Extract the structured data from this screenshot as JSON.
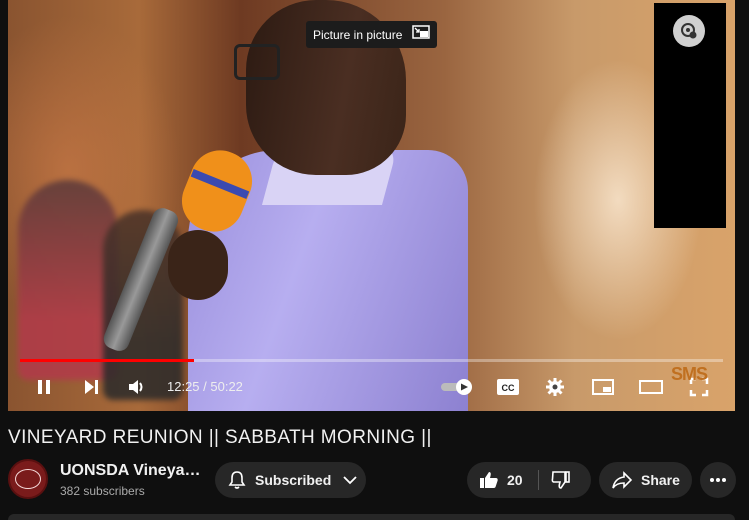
{
  "player": {
    "tooltip": "Picture in picture",
    "time": "12:25 / 50:22",
    "progress": 0.247,
    "watermark": "SMS",
    "accent": "#ff0000"
  },
  "video": {
    "title": "VINEYARD REUNION || SABBATH MORNING ||"
  },
  "channel": {
    "name": "UONSDA Vineya…",
    "subscribers": "382 subscribers"
  },
  "actions": {
    "subscribe_label": "Subscribed",
    "like_count": "20",
    "share_label": "Share"
  },
  "icons": [
    "pause-icon",
    "next-icon",
    "volume-icon",
    "autoplay-toggle",
    "captions-icon",
    "settings-icon",
    "miniplayer-icon",
    "theater-icon",
    "fullscreen-icon",
    "bell-icon",
    "chevron-down-icon",
    "like-icon",
    "dislike-icon",
    "share-icon",
    "more-icon",
    "cast-icon",
    "pip-icon"
  ]
}
